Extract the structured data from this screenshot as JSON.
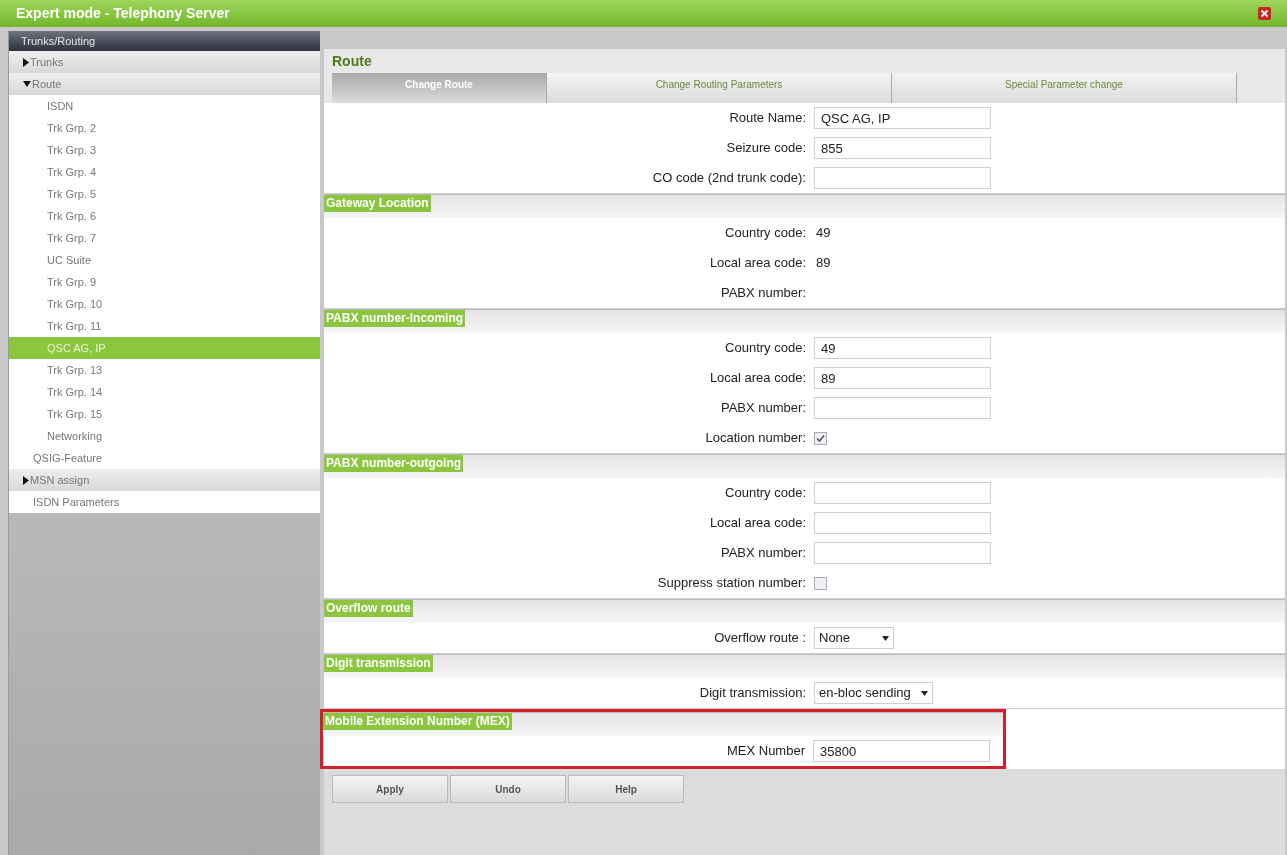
{
  "window": {
    "title": "Expert mode - Telephony Server"
  },
  "sidebar": {
    "header": "Trunks/Routing",
    "items": [
      {
        "label": "Trunks",
        "kind": "group",
        "expanded": false,
        "selected": false
      },
      {
        "label": "Route",
        "kind": "group",
        "expanded": true,
        "selected": false,
        "children": [
          {
            "label": "ISDN",
            "selected": false
          },
          {
            "label": "Trk Grp. 2",
            "selected": false
          },
          {
            "label": "Trk Grp. 3",
            "selected": false
          },
          {
            "label": "Trk Grp. 4",
            "selected": false
          },
          {
            "label": "Trk Grp. 5",
            "selected": false
          },
          {
            "label": "Trk Grp. 6",
            "selected": false
          },
          {
            "label": "Trk Grp. 7",
            "selected": false
          },
          {
            "label": "UC Suite",
            "selected": false
          },
          {
            "label": "Trk Grp. 9",
            "selected": false
          },
          {
            "label": "Trk Grp. 10",
            "selected": false
          },
          {
            "label": "Trk Grp. 11",
            "selected": false
          },
          {
            "label": "QSC AG, IP",
            "selected": true
          },
          {
            "label": "Trk Grp. 13",
            "selected": false
          },
          {
            "label": "Trk Grp. 14",
            "selected": false
          },
          {
            "label": "Trk Grp. 15",
            "selected": false
          },
          {
            "label": "Networking",
            "selected": false
          }
        ]
      },
      {
        "label": "QSIG-Feature",
        "kind": "link",
        "selected": false
      },
      {
        "label": "MSN assign",
        "kind": "group",
        "expanded": false,
        "selected": false
      },
      {
        "label": "ISDN Parameters",
        "kind": "link",
        "selected": false
      }
    ]
  },
  "content": {
    "title": "Route",
    "tabs": [
      {
        "label": "Change Route",
        "selected": true
      },
      {
        "label": "Change Routing Parameters",
        "selected": false
      },
      {
        "label": "Special Parameter change",
        "selected": false
      }
    ],
    "sections": [
      {
        "fields": [
          {
            "label": "Route Name:",
            "kind": "text",
            "value": "QSC AG, IP"
          },
          {
            "label": "Seizure code:",
            "kind": "text",
            "value": "855"
          },
          {
            "label": "CO code (2nd trunk code):",
            "kind": "text"
          }
        ]
      },
      {
        "title": "Gateway Location",
        "fields": [
          {
            "label": "Country code:",
            "kind": "readonly",
            "value": "49"
          },
          {
            "label": "Local area code:",
            "kind": "readonly",
            "value": "89"
          },
          {
            "label": "PABX number:",
            "kind": "readonly"
          }
        ]
      },
      {
        "title": "PABX number-Incoming",
        "fields": [
          {
            "label": "Country code:",
            "kind": "text",
            "value": "49"
          },
          {
            "label": "Local area code:",
            "kind": "text",
            "value": "89"
          },
          {
            "label": "PABX number:",
            "kind": "text"
          },
          {
            "label": "Location number:",
            "kind": "checkbox",
            "checked": true
          }
        ]
      },
      {
        "title": "PABX number-outgoing",
        "fields": [
          {
            "label": "Country code:",
            "kind": "text"
          },
          {
            "label": "Local area code:",
            "kind": "text"
          },
          {
            "label": "PABX number:",
            "kind": "text"
          },
          {
            "label": "Suppress station number:",
            "kind": "checkbox",
            "checked": false
          }
        ]
      },
      {
        "title": "Overflow route",
        "fields": [
          {
            "label": "Overflow route :",
            "kind": "select",
            "value": "None"
          }
        ]
      },
      {
        "title": "Digit transmission",
        "fields": [
          {
            "label": "Digit transmission:",
            "kind": "select",
            "value": "en-bloc sending"
          }
        ]
      },
      {
        "title": "Mobile Extension Number (MEX)",
        "highlighted": true,
        "fields": [
          {
            "label": "MEX Number",
            "kind": "text",
            "value": "35800"
          }
        ]
      }
    ],
    "buttons": [
      "Apply",
      "Undo",
      "Help"
    ]
  }
}
